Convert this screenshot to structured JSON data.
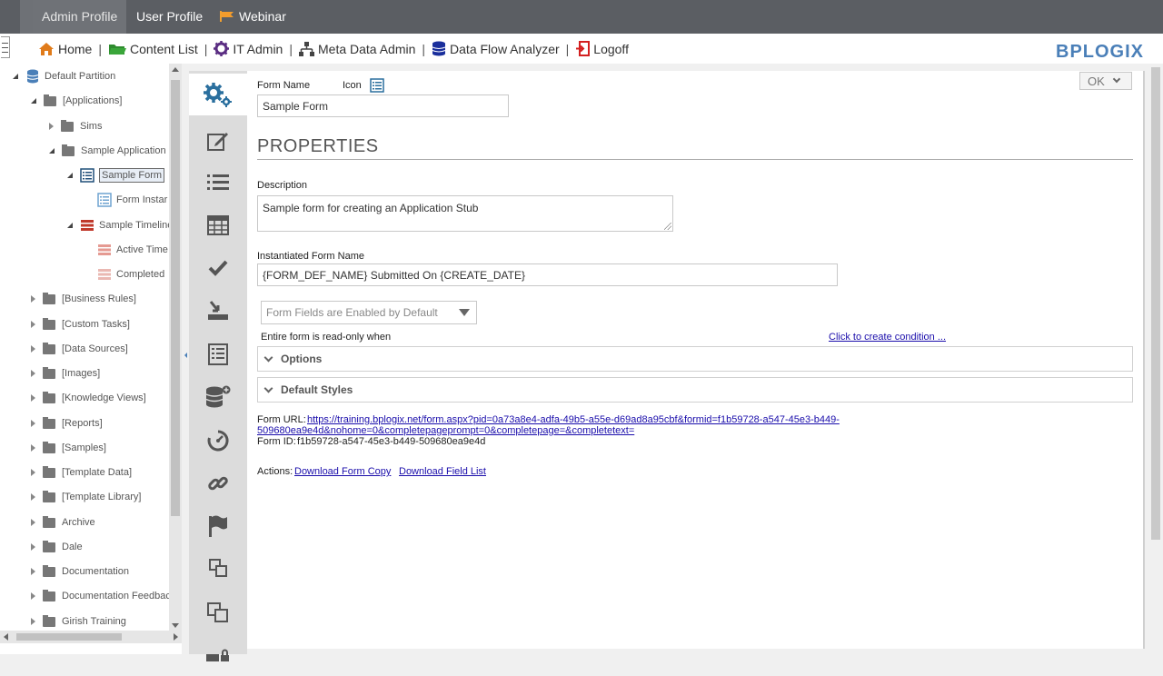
{
  "topbar": {
    "tabs": [
      {
        "label": "Admin Profile",
        "active": true
      },
      {
        "label": "User Profile",
        "active": false
      },
      {
        "label": "Webinar",
        "active": false
      }
    ]
  },
  "navbar": {
    "items": [
      {
        "label": "Home",
        "icon": "home-icon"
      },
      {
        "label": "Content List",
        "icon": "folder-icon"
      },
      {
        "label": "IT Admin",
        "icon": "gear-icon"
      },
      {
        "label": "Meta Data Admin",
        "icon": "hierarchy-icon"
      },
      {
        "label": "Data Flow Analyzer",
        "icon": "database-icon"
      },
      {
        "label": "Logoff",
        "icon": "logoff-icon"
      }
    ],
    "separator": "|",
    "logo": "BPLOGIX"
  },
  "tree": {
    "items": [
      {
        "label": "Default Partition",
        "type": "database",
        "state": "open"
      },
      {
        "label": "[Applications]",
        "type": "folder",
        "state": "open"
      },
      {
        "label": "Sims",
        "type": "folder",
        "state": "closed"
      },
      {
        "label": "Sample Application",
        "type": "folder",
        "state": "open"
      },
      {
        "label": "Sample Form",
        "type": "form",
        "state": "open",
        "selected": true
      },
      {
        "label": "Form Instar",
        "type": "form-light",
        "state": "none"
      },
      {
        "label": "Sample Timeline",
        "type": "timeline",
        "state": "open"
      },
      {
        "label": "Active Time",
        "type": "timeline-light",
        "state": "none"
      },
      {
        "label": "Completed",
        "type": "timeline-lighter",
        "state": "none"
      },
      {
        "label": "[Business Rules]",
        "type": "folder",
        "state": "closed"
      },
      {
        "label": "[Custom Tasks]",
        "type": "folder",
        "state": "closed"
      },
      {
        "label": "[Data Sources]",
        "type": "folder",
        "state": "closed"
      },
      {
        "label": "[Images]",
        "type": "folder",
        "state": "closed"
      },
      {
        "label": "[Knowledge Views]",
        "type": "folder",
        "state": "closed"
      },
      {
        "label": "[Reports]",
        "type": "folder",
        "state": "closed"
      },
      {
        "label": "[Samples]",
        "type": "folder",
        "state": "closed"
      },
      {
        "label": "[Template Data]",
        "type": "folder",
        "state": "closed"
      },
      {
        "label": "[Template Library]",
        "type": "folder",
        "state": "closed"
      },
      {
        "label": "Archive",
        "type": "folder",
        "state": "closed"
      },
      {
        "label": "Dale",
        "type": "folder",
        "state": "closed"
      },
      {
        "label": "Documentation",
        "type": "folder",
        "state": "closed"
      },
      {
        "label": "Documentation Feedbac",
        "type": "folder",
        "state": "closed"
      },
      {
        "label": "Girish Training",
        "type": "folder",
        "state": "closed"
      }
    ]
  },
  "strip": {
    "icons": [
      "gears-icon",
      "edit-icon",
      "list-icon",
      "table-icon",
      "checkmark-icon",
      "import-icon",
      "form-list-icon",
      "database-add-icon",
      "timer-icon",
      "link-icon",
      "flag-icon",
      "copy-icon",
      "duplicate-icon",
      "lock-icon"
    ]
  },
  "form": {
    "form_name_label": "Form Name",
    "icon_label": "Icon",
    "form_name_value": "Sample Form",
    "properties_heading": "PROPERTIES",
    "description_label": "Description",
    "description_value": "Sample form for creating an Application Stub",
    "instantiated_label": "Instantiated Form Name",
    "instantiated_value": "{FORM_DEF_NAME} Submitted On {CREATE_DATE}",
    "fields_select_value": "Form Fields are Enabled by Default",
    "readonly_label": "Entire form is read-only when",
    "create_condition_link": "Click to create condition ...",
    "options_section": "Options",
    "default_styles_section": "Default Styles",
    "form_url_label": "Form URL:",
    "form_url_line1": "https://training.bplogix.net/form.aspx?pid=0a73a8e4-adfa-49b5-a55e-d69ad8a95cbf&formid=f1b59728-a547-45e3-b449-",
    "form_url_line2": "509680ea9e4d&nohome=0&completepageprompt=0&completepage=&completetext=",
    "form_id_label": "Form ID:",
    "form_id_value": "f1b59728-a547-45e3-b449-509680ea9e4d",
    "actions_label": "Actions:",
    "download_form_copy": "Download Form Copy",
    "download_field_list": "Download Field List"
  },
  "ok_button": {
    "label": "OK"
  },
  "colors": {
    "topbar": "#5b5e63",
    "accent_blue": "#4a7fb8",
    "link": "#1a0dab",
    "strip": "#dcdcdc"
  }
}
